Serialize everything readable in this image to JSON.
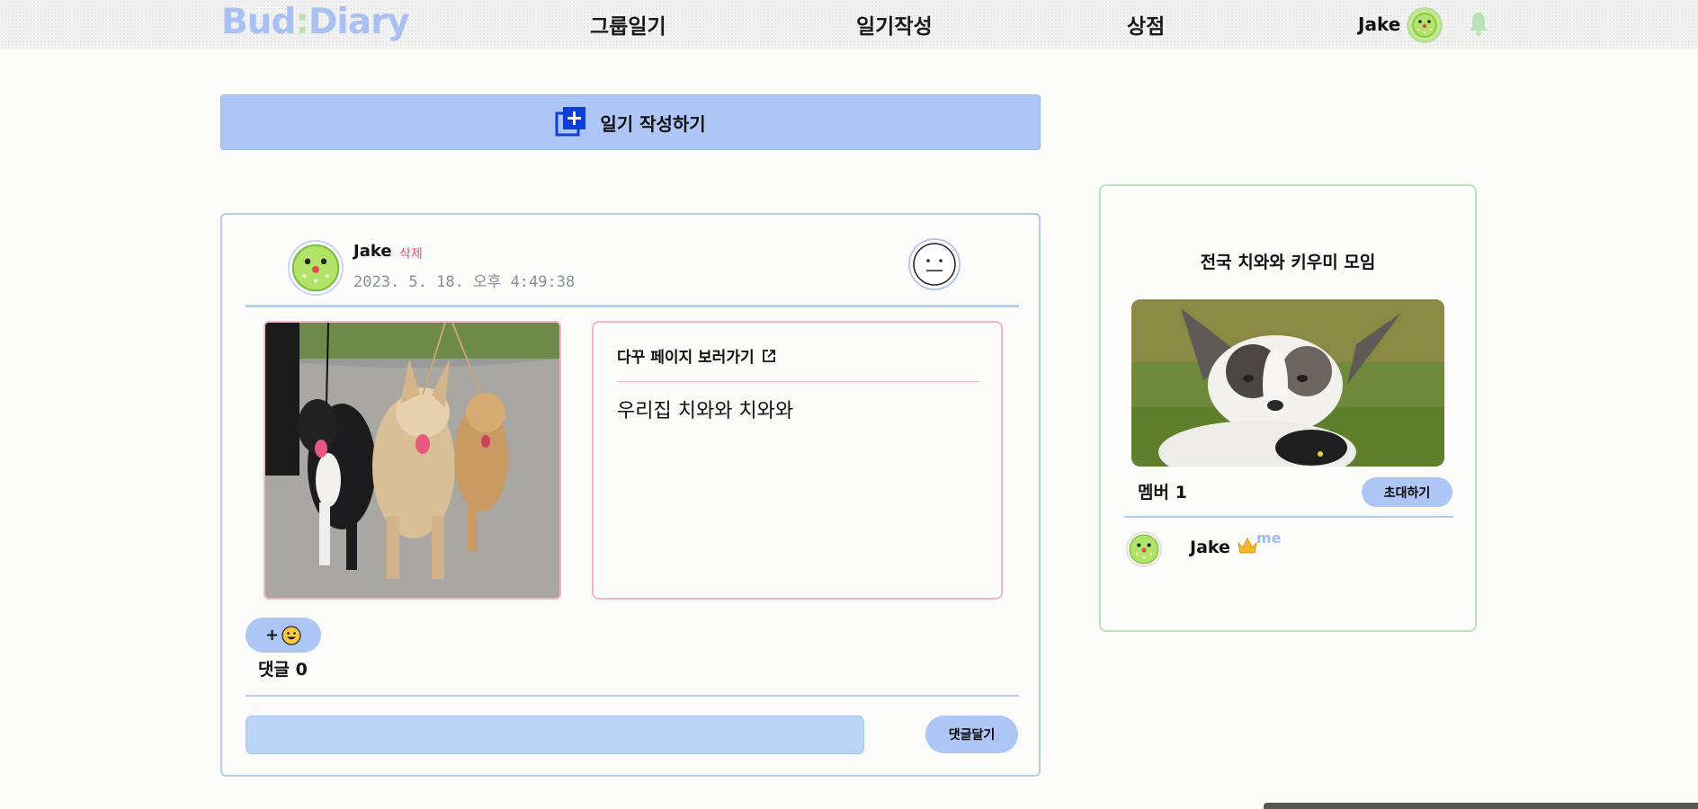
{
  "header": {
    "logo_part1": "Bud",
    "logo_colon": ":",
    "logo_part2": "Diary",
    "nav": [
      "그룹일기",
      "일기작성",
      "상점"
    ],
    "user_name": "Jake"
  },
  "write_button": {
    "label": "일기 작성하기"
  },
  "post": {
    "author": "Jake",
    "delete_label": "삭제",
    "date": "2023. 5. 18. 오후 4:49:38",
    "dakku_link": "다꾸 페이지 보러가기",
    "content": "우리집 치와와 치와와",
    "reaction_label": "+",
    "comment_count": "댓글 0",
    "comment_placeholder": "",
    "comment_button": "댓글달기"
  },
  "group": {
    "title": "전국 치와와 키우미 모임",
    "member_count": "멤버 1",
    "invite_button": "초대하기",
    "members": [
      {
        "name": "Jake",
        "tag": "me"
      }
    ]
  },
  "colors": {
    "accent_blue": "#aec6f6",
    "accent_green": "#bfe3b0",
    "delete_red": "#e0526e",
    "image_border_pink": "#f2b5c3"
  }
}
